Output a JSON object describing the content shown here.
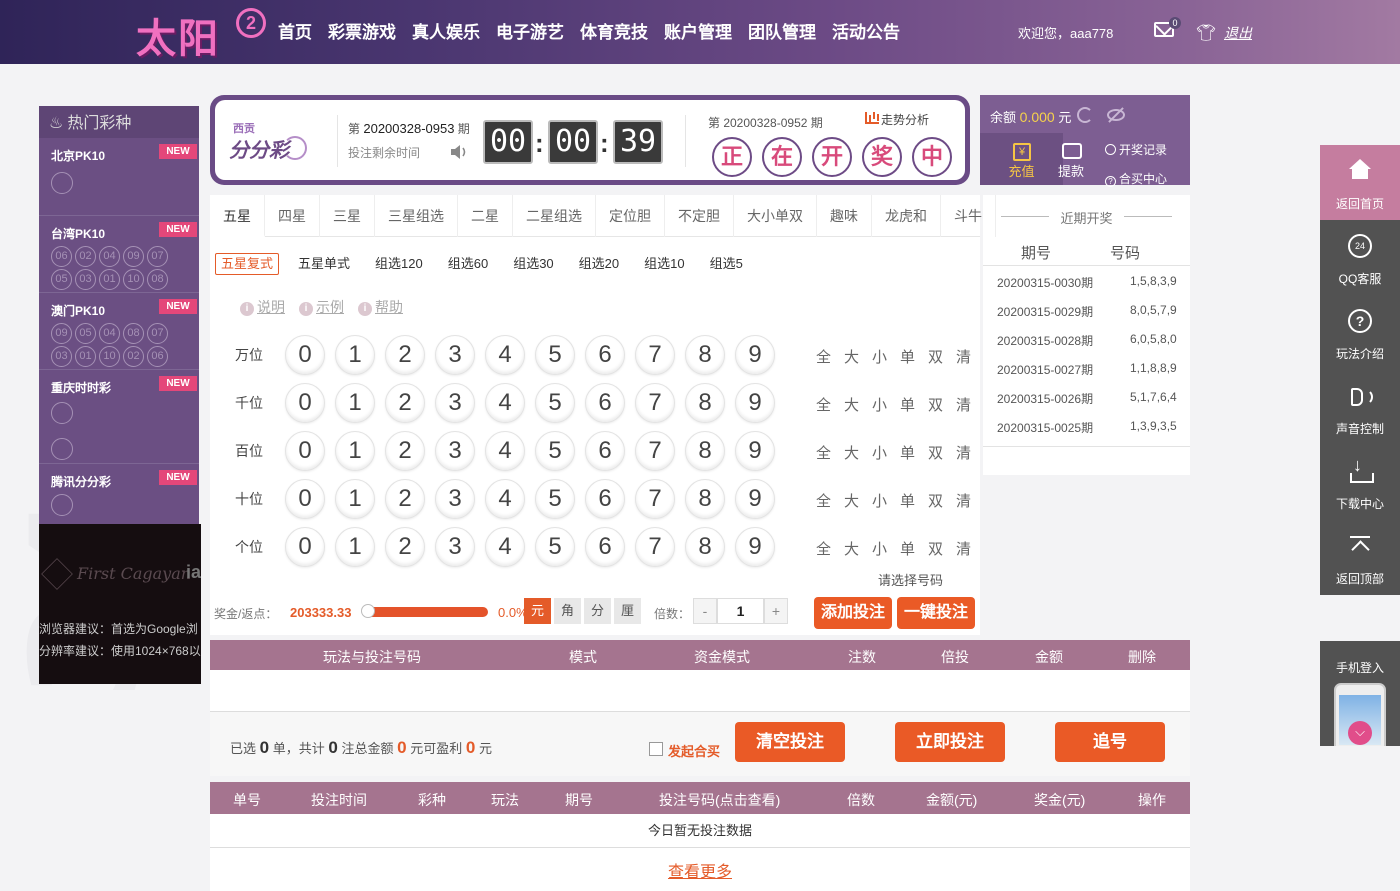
{
  "header": {
    "logo_text": "太阳",
    "logo_badge": "2",
    "nav": [
      "首页",
      "彩票游戏",
      "真人娱乐",
      "电子游艺",
      "体育竞技",
      "账户管理",
      "团队管理",
      "活动公告"
    ],
    "welcome": "欢迎您，aaa778",
    "mail_count": "0",
    "logout": "退出"
  },
  "sidebar": {
    "title": "热门彩种",
    "new_badge": "NEW",
    "lotteries": [
      {
        "name": "北京PK10",
        "balls": []
      },
      {
        "name": "台湾PK10",
        "balls": [
          "06",
          "02",
          "04",
          "09",
          "07",
          "05",
          "03",
          "01",
          "10",
          "08"
        ]
      },
      {
        "name": "澳门PK10",
        "balls": [
          "09",
          "05",
          "04",
          "08",
          "07",
          "03",
          "01",
          "10",
          "02",
          "06"
        ]
      },
      {
        "name": "重庆时时彩",
        "balls": []
      },
      {
        "name": "腾讯分分彩",
        "balls": []
      }
    ]
  },
  "ad": {
    "brand": "First Cagayan",
    "brand_tail": "ia",
    "line1": "浏览器建议：首选为Google浏",
    "line2": "分辨率建议：使用1024×768以"
  },
  "game": {
    "logo_sub": "西贡",
    "logo": "分分彩",
    "current_issue_prefix": "第",
    "current_issue": "20200328-0953",
    "current_issue_suffix": "期",
    "remain_label": "投注剩余时间",
    "time": [
      "00",
      "00",
      "39"
    ],
    "prev_issue_text": "第 20200328-0952 期",
    "trend_link": "走势分析",
    "draw_status": [
      "正",
      "在",
      "开",
      "奖",
      "中"
    ]
  },
  "account": {
    "balance_label": "余额",
    "balance_value": "0.000",
    "balance_unit": "元",
    "recharge": "充值",
    "withdraw": "提款",
    "records": "开奖记录",
    "hemai": "合买中心"
  },
  "recent": {
    "title": "近期开奖",
    "col_issue": "期号",
    "col_code": "号码",
    "rows": [
      {
        "issue": "20200315-0030期",
        "code": "1,5,8,3,9"
      },
      {
        "issue": "20200315-0029期",
        "code": "8,0,5,7,9"
      },
      {
        "issue": "20200315-0028期",
        "code": "6,0,5,8,0"
      },
      {
        "issue": "20200315-0027期",
        "code": "1,1,8,8,9"
      },
      {
        "issue": "20200315-0026期",
        "code": "5,1,7,6,4"
      },
      {
        "issue": "20200315-0025期",
        "code": "1,3,9,3,5"
      }
    ]
  },
  "bet": {
    "play_tabs": [
      "五星",
      "四星",
      "三星",
      "三星组选",
      "二星",
      "二星组选",
      "定位胆",
      "不定胆",
      "大小单双",
      "趣味",
      "龙虎和",
      "斗牛"
    ],
    "active_play_tab": 0,
    "sub_tabs": [
      "五星复式",
      "五星单式",
      "组选120",
      "组选60",
      "组选30",
      "组选20",
      "组选10",
      "组选5"
    ],
    "active_sub_tab": 0,
    "help_links": [
      "说明",
      "示例",
      "帮助"
    ],
    "positions": [
      "万位",
      "千位",
      "百位",
      "十位",
      "个位"
    ],
    "numbers": [
      "0",
      "1",
      "2",
      "3",
      "4",
      "5",
      "6",
      "7",
      "8",
      "9"
    ],
    "quick_picks": [
      "全",
      "大",
      "小",
      "单",
      "双",
      "清"
    ],
    "pick_hint": "请选择号码",
    "bonus_label": "奖金/返点：",
    "bonus_value": "203333.33",
    "rebate_value": "0.0%",
    "units": [
      "元",
      "角",
      "分",
      "厘"
    ],
    "active_unit": 0,
    "multiple_label": "倍数：",
    "multiple_minus": "-",
    "multiple_plus": "+",
    "multiple_value": "1",
    "add_bet": "添加投注",
    "one_click_bet": "一键投注"
  },
  "cart": {
    "headers": [
      "玩法与投注号码",
      "模式",
      "资金模式",
      "注数",
      "倍投",
      "金额",
      "删除"
    ],
    "summary_selected_prefix": "已选",
    "summary_selected": "0",
    "summary_units_text": "单，共计",
    "summary_bets": "0",
    "summary_amount_text": "注总金额",
    "summary_amount": "0",
    "summary_profit_text": "元可盈利",
    "summary_profit": "0",
    "summary_yuan": "元",
    "hemai_label": "发起合买",
    "clear_btn": "清空投注",
    "bet_now_btn": "立即投注",
    "chase_btn": "追号"
  },
  "records": {
    "headers": [
      "单号",
      "投注时间",
      "彩种",
      "玩法",
      "期号",
      "投注号码(点击查看)",
      "倍数",
      "金额(元)",
      "奖金(元)",
      "操作"
    ],
    "empty_text": "今日暂无投注数据",
    "more": "查看更多"
  },
  "float_bar": {
    "items": [
      "返回首页",
      "QQ客服",
      "玩法介绍",
      "声音控制",
      "下载中心",
      "返回顶部"
    ],
    "qq_icon_text": "24",
    "mobile_login": "手机登入"
  },
  "watermark": "34"
}
